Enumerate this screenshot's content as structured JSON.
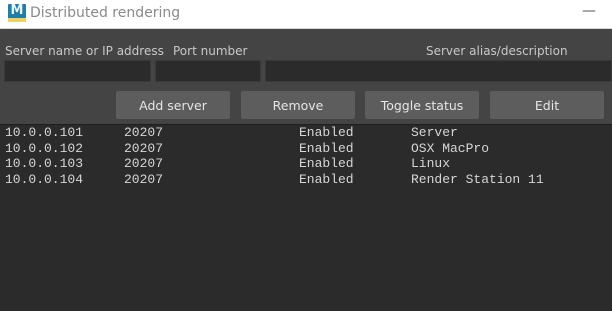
{
  "window": {
    "title": "Distributed rendering",
    "app_icon": {
      "letter": "M",
      "name": "maya-icon"
    },
    "minimize_glyph": "—"
  },
  "form": {
    "server_label": "Server name or IP address",
    "port_label": "Port number",
    "alias_label": "Server alias/description",
    "server_value": "",
    "port_value": "",
    "alias_value": ""
  },
  "buttons": {
    "add": "Add server",
    "remove": "Remove",
    "toggle": "Toggle status",
    "edit": "Edit"
  },
  "servers": [
    {
      "ip": "10.0.0.101",
      "port": "20207",
      "status": "Enabled",
      "alias": "Server"
    },
    {
      "ip": "10.0.0.102",
      "port": "20207",
      "status": "Enabled",
      "alias": "OSX MacPro"
    },
    {
      "ip": "10.0.0.103",
      "port": "20207",
      "status": "Enabled",
      "alias": "Linux"
    },
    {
      "ip": "10.0.0.104",
      "port": "20207",
      "status": "Enabled",
      "alias": "Render Station 11"
    }
  ],
  "colors": {
    "panel_bg": "#444444",
    "list_bg": "#2b2b2b",
    "button_bg": "#5d5d5d",
    "icon_bg": "#1e7fa8"
  }
}
